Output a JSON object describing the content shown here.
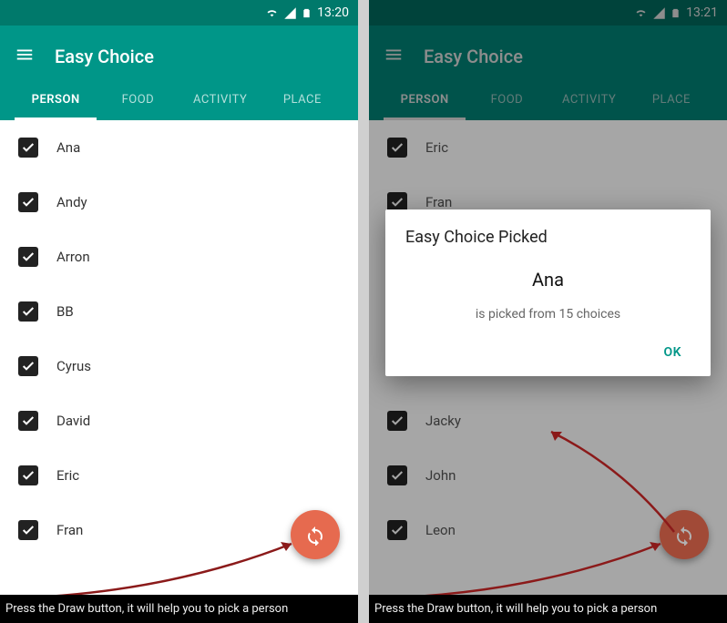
{
  "left": {
    "status_time": "13:20",
    "app_title": "Easy Choice",
    "tabs": [
      "PERSON",
      "FOOD",
      "ACTIVITY",
      "PLACE"
    ],
    "active_tab": 0,
    "items": [
      "Ana",
      "Andy",
      "Arron",
      "BB",
      "Cyrus",
      "David",
      "Eric",
      "Fran"
    ],
    "hint": "Press the Draw button, it will help you to  pick a person"
  },
  "right": {
    "status_time": "13:21",
    "app_title": "Easy Choice",
    "tabs": [
      "PERSON",
      "FOOD",
      "ACTIVITY",
      "PLACE"
    ],
    "active_tab": 0,
    "items": [
      "Eric",
      "Fran",
      "",
      "",
      "",
      "Jacky",
      "John",
      "Leon"
    ],
    "hint": "Press the Draw button, it will help you to  pick a person",
    "dialog": {
      "title": "Easy Choice Picked",
      "picked_name": "Ana",
      "subtitle": "is picked from 15 choices",
      "ok_label": "OK"
    }
  }
}
